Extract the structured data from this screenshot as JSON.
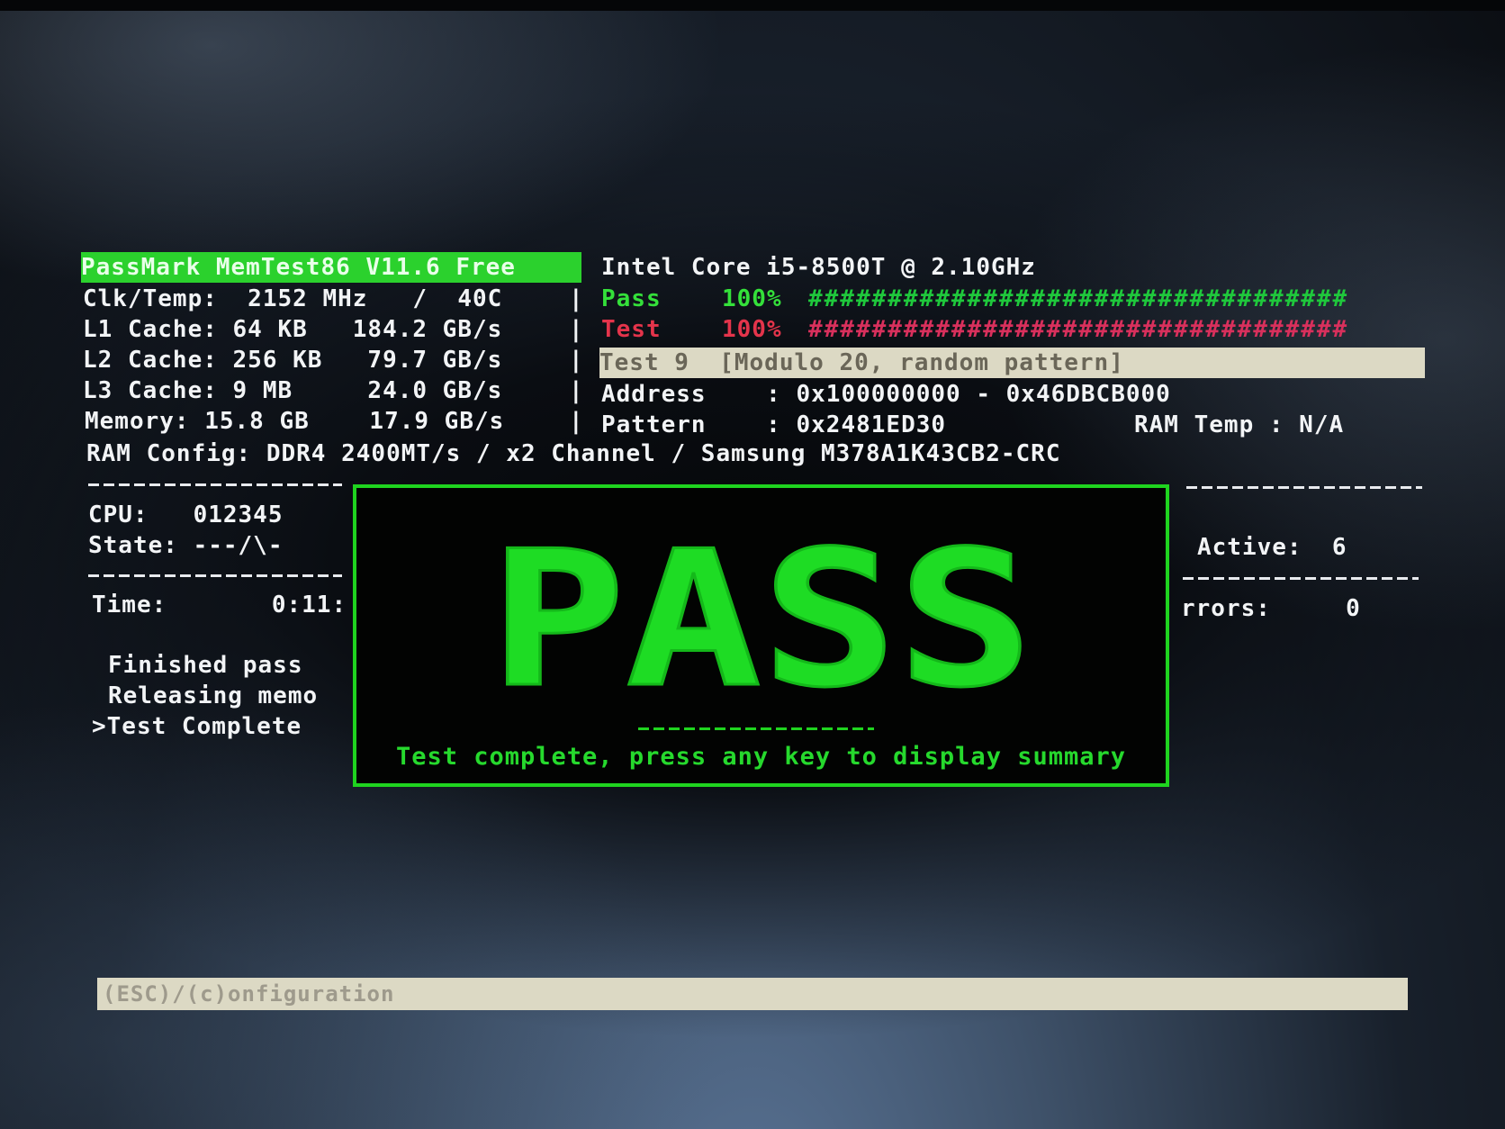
{
  "header": {
    "product": "PassMark MemTest86 V11.6 Free",
    "cpu_model": "Intel Core i5-8500T @ 2.10GHz"
  },
  "system": {
    "clk_temp": "Clk/Temp:  2152 MHz   /  40C",
    "l1": "L1 Cache: 64 KB   184.2 GB/s",
    "l2": "L2 Cache: 256 KB   79.7 GB/s",
    "l3": "L3 Cache: 9 MB     24.0 GB/s",
    "memory": "Memory: 15.8 GB    17.9 GB/s",
    "ram_config": "RAM Config: DDR4 2400MT/s / x2 Channel / Samsung M378A1K43CB2-CRC",
    "separator": "|"
  },
  "progress": {
    "pass_label": "Pass",
    "pass_pct": "100%",
    "pass_fraction": 1.0,
    "pass_bar": "##################################",
    "test_label": "Test",
    "test_pct": "100%",
    "test_fraction": 1.0,
    "test_bar": "##################################",
    "current_test": "Test 9  [Modulo 20, random pattern]",
    "address": "Address    : 0x100000000 - 0x46DBCB000",
    "pattern": "Pattern    : 0x2481ED30",
    "ram_temp": "RAM Temp : N/A"
  },
  "left_status": {
    "cpu": "CPU:   012345",
    "state": "State: ---/\\-",
    "time": "Time:       0:11:",
    "log": [
      "Finished pass",
      "Releasing memo",
      ">Test Complete"
    ]
  },
  "right_status": {
    "active": "Active:  6",
    "errors": "rrors:     0"
  },
  "result": {
    "banner": "PASS",
    "message": "Test complete, press any key to display summary"
  },
  "footer": {
    "config_hint": "(ESC)/(c)onfiguration"
  },
  "colors": {
    "accent_green": "#26d92d",
    "error_red": "#e4344b",
    "status_bar_bg": "#dcd9c4"
  }
}
